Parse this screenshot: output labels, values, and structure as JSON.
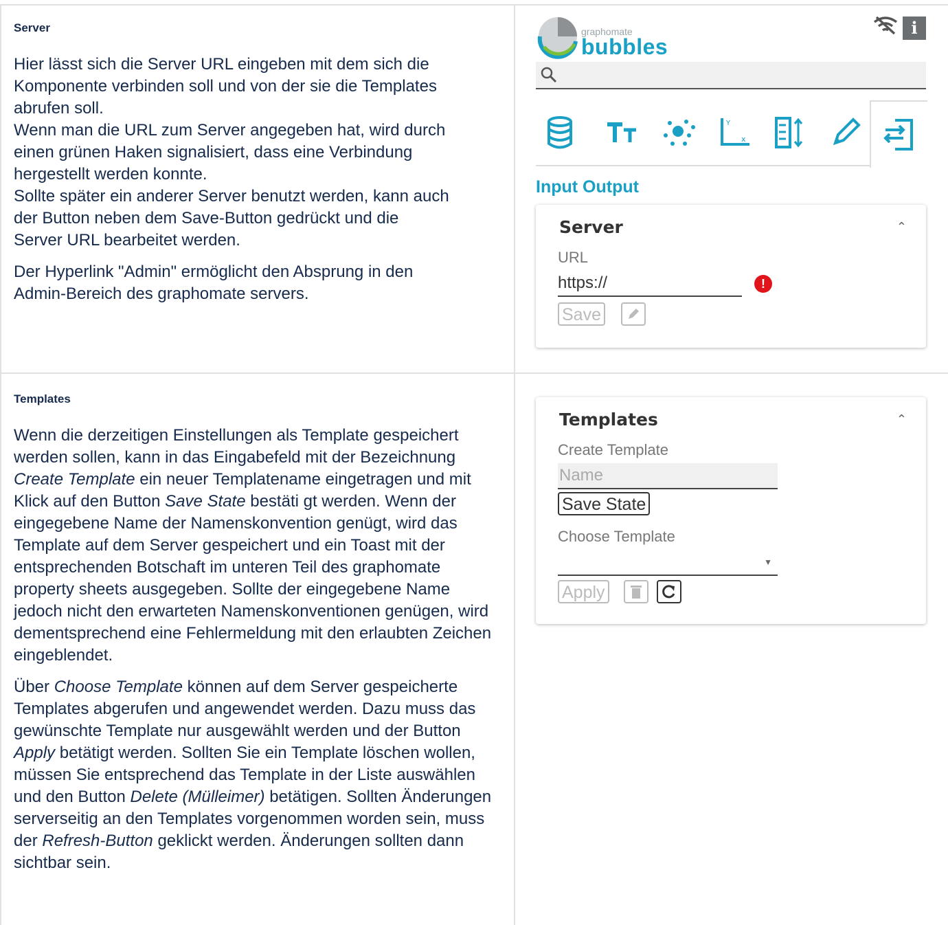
{
  "server_section": {
    "heading": "Server",
    "paragraph1_lines": [
      "Hier lässt sich die Server URL eingeben mit dem sich die",
      "Komponente verbinden soll und von der sie die Templates",
      "abrufen soll.",
      "Wenn man die URL zum Server angegeben hat, wird durch",
      "einen grünen Haken signalisiert, dass eine Verbindung",
      "hergestellt werden konnte.",
      "Sollte später ein anderer Server benutzt werden, kann auch",
      "der Button neben dem Save-Button gedrückt und die",
      "Server URL bearbeitet werden."
    ],
    "paragraph2_lines": [
      "Der Hyperlink \"Admin\" ermöglicht den Absprung in den",
      "Admin-Bereich des graphomate servers."
    ]
  },
  "templates_section": {
    "heading": "Templates",
    "p1": {
      "a": "Wenn die derzeitigen Einstellungen als Template gespeichert werden sollen, kann in das Eingabefeld mit der Bezeichnung ",
      "i1": "Create Template",
      "b": " ein neuer Templatename eingetragen und mit Klick auf den Button ",
      "i2": "Save State",
      "c": " bestäti gt werden. Wenn der eingegebene Name der Namenskonvention genügt, wird das Template auf dem Server gespeichert und ein Toast mit der entsprechenden Botschaft im unteren Teil des graphomate property sheets ausgegeben. Sollte der eingegebene Name jedoch nicht den erwarteten Namenskonventionen genügen, wird dementsprechend eine Fehlermeldung mit den erlaubten Zeichen eingeblendet."
    },
    "p2": {
      "a": "Über ",
      "i1": "Choose Template",
      "b": " können auf dem Server gespeicherte Templates abgerufen und angewendet werden. Dazu muss das gewünschte Template nur ausgewählt werden und der Button ",
      "i2": "Apply",
      "c": " betätigt werden. Sollten Sie ein Template löschen wollen, müssen Sie entsprechend das Template in der Liste auswählen und den Button ",
      "i3": "Delete (Mülleimer)",
      "d": " betätigen. Sollten Änderungen serverseitig an den Templates vorgenommen worden sein, muss der ",
      "i4": "Refresh-Button",
      "e": " geklickt werden. Änderungen sollten dann sichtbar sein."
    }
  },
  "panel": {
    "logo_small": "graphomate",
    "logo_big": "bubbles",
    "info_label": "i",
    "tabs": [
      "database-icon",
      "text-size-icon",
      "scatter-icon",
      "axis-icon",
      "columns-sort-icon",
      "pencil-icon",
      "input-output-icon"
    ],
    "section_title": "Input Output",
    "server_card": {
      "title": "Server",
      "url_label": "URL",
      "url_value": "https://",
      "save_label": "Save"
    },
    "templates_card": {
      "title": "Templates",
      "create_label": "Create Template",
      "name_placeholder": "Name",
      "save_state_label": "Save State",
      "choose_label": "Choose Template",
      "apply_label": "Apply"
    },
    "colors": {
      "accent": "#1aa0c4",
      "error": "#e0141a",
      "icon_blue": "#1aa0c4"
    }
  }
}
